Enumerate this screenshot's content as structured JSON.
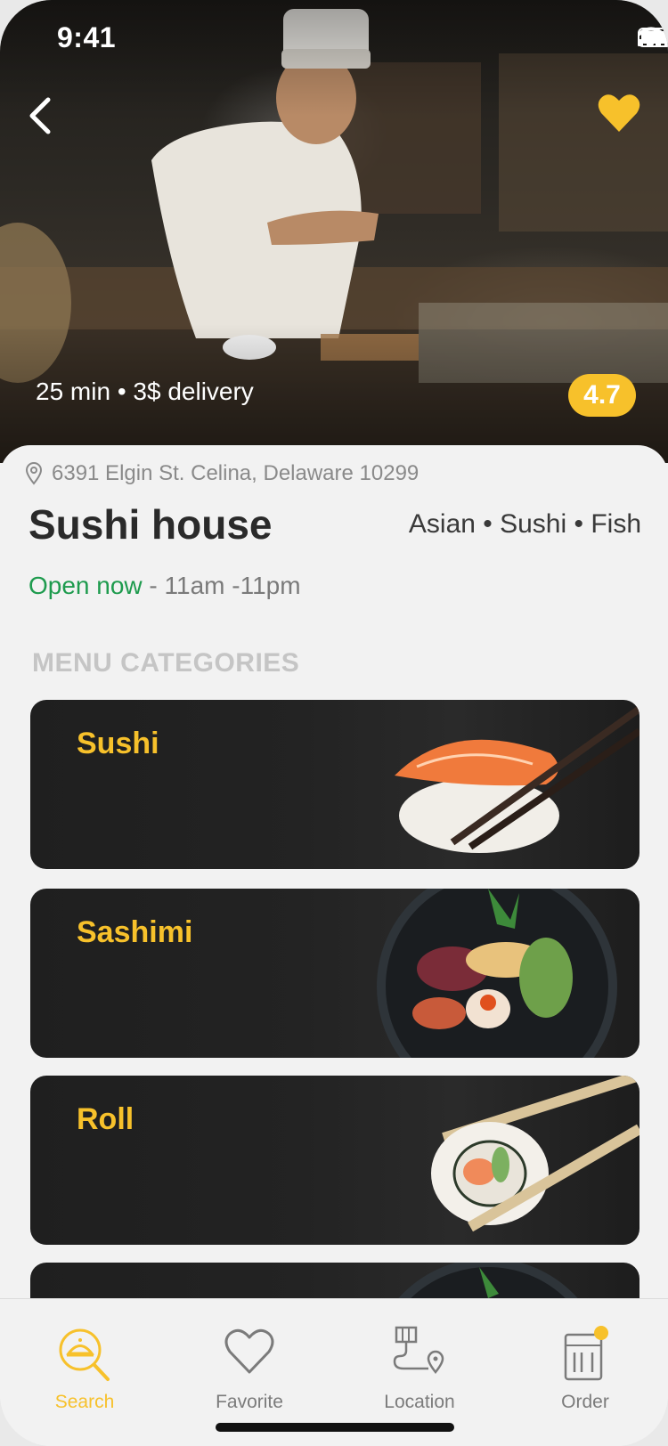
{
  "status_bar": {
    "time": "9:41"
  },
  "hero": {
    "delivery_info": "25 min • 3$ delivery",
    "rating": "4.7"
  },
  "restaurant": {
    "address": "6391 Elgin St. Celina, Delaware 10299",
    "name": "Sushi house",
    "cuisines": "Asian • Sushi • Fish",
    "open_status": "Open now",
    "hours": " - 11am -11pm"
  },
  "menu": {
    "section_title": "MENU CATEGORIES",
    "categories": [
      {
        "label": "Sushi"
      },
      {
        "label": "Sashimi"
      },
      {
        "label": "Roll"
      }
    ]
  },
  "tabbar": {
    "items": [
      {
        "label": "Search",
        "icon": "search-food-icon",
        "active": true
      },
      {
        "label": "Favorite",
        "icon": "heart-icon",
        "active": false
      },
      {
        "label": "Location",
        "icon": "location-route-icon",
        "active": false
      },
      {
        "label": "Order",
        "icon": "order-bag-icon",
        "active": false
      }
    ]
  },
  "colors": {
    "accent": "#f7c12b",
    "open_green": "#1e9b4e",
    "card_bg": "#222222",
    "sheet_bg": "#f2f2f2"
  }
}
